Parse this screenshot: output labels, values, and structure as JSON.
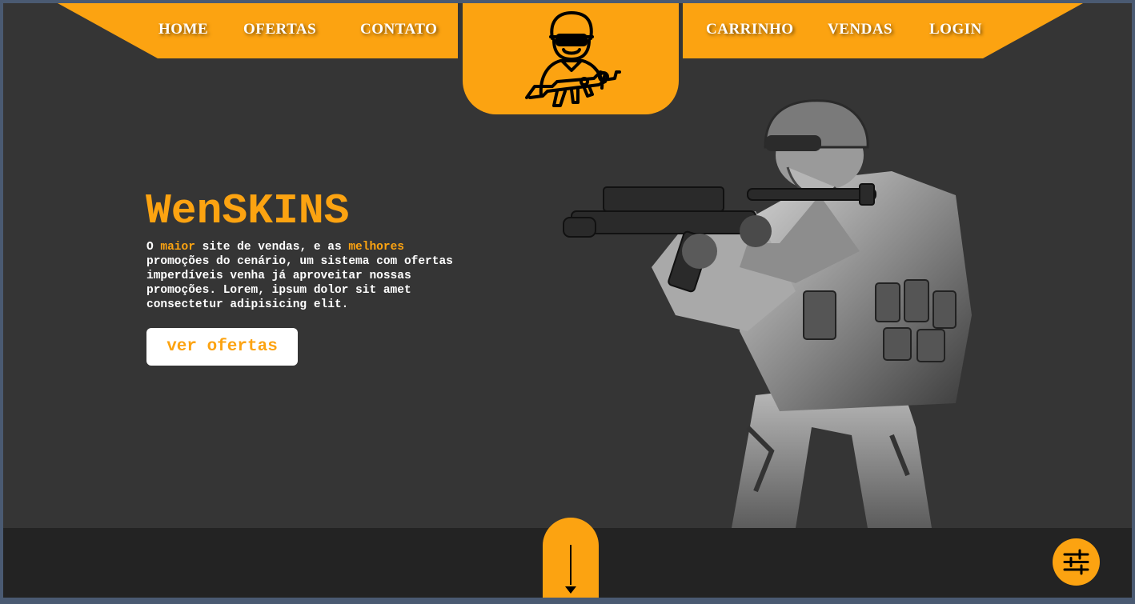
{
  "nav": {
    "left": [
      "HOME",
      "OFERTAS",
      "CONTATO"
    ],
    "right": [
      "CARRINHO",
      "VENDAS",
      "LOGIN"
    ]
  },
  "logo": {
    "icon": "soldier-with-rifle-icon"
  },
  "hero": {
    "title": "WenSKINS",
    "text_parts": [
      "O ",
      "maior",
      " site de vendas, e as ",
      "melhores",
      " promoções do cenário, um sistema com ofertas imperdíveis venha já aproveitar nossas promoções. Lorem, ipsum dolor sit amet consectetur adipisicing elit."
    ],
    "cta_label": "ver ofertas"
  },
  "scroll": {
    "icon": "arrow-down-icon"
  },
  "settings": {
    "icon": "sliders-icon"
  },
  "colors": {
    "accent": "#fca311",
    "background": "#353535",
    "footer": "#232323",
    "text": "#ffffff"
  }
}
